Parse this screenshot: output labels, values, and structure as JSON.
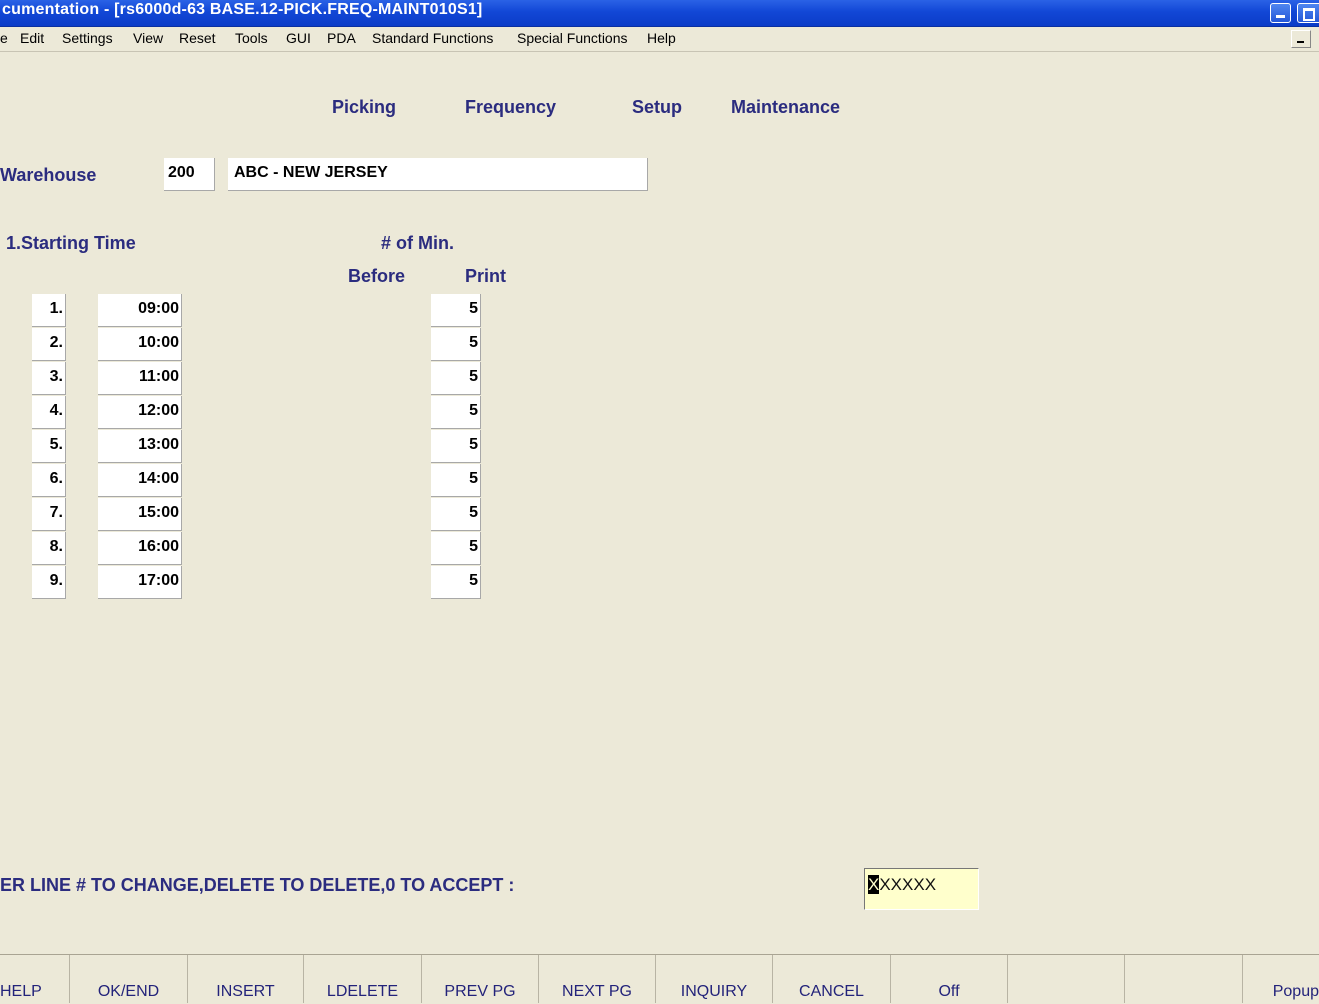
{
  "window": {
    "title": "cumentation - [rs6000d-63 BASE.12-PICK.FREQ-MAINT010S1]"
  },
  "menu": [
    "e",
    "Edit",
    "Settings",
    "View",
    "Reset",
    "Tools",
    "GUI",
    "PDA",
    "Standard Functions",
    "Special Functions",
    "Help"
  ],
  "screen": {
    "title_words": [
      "Picking",
      "Frequency",
      "Setup",
      "Maintenance"
    ],
    "warehouse_label": "Warehouse",
    "warehouse_code": "200",
    "warehouse_name": "ABC -  NEW JERSEY",
    "section_label": "1.Starting Time",
    "col_min_label": "# of Min.",
    "col_before_label": "Before",
    "col_print_label": "Print"
  },
  "rows": [
    {
      "line": "1.",
      "time": "09:00",
      "minutes": "5"
    },
    {
      "line": "2.",
      "time": "10:00",
      "minutes": "5"
    },
    {
      "line": "3.",
      "time": "11:00",
      "minutes": "5"
    },
    {
      "line": "4.",
      "time": "12:00",
      "minutes": "5"
    },
    {
      "line": "5.",
      "time": "13:00",
      "minutes": "5"
    },
    {
      "line": "6.",
      "time": "14:00",
      "minutes": "5"
    },
    {
      "line": "7.",
      "time": "15:00",
      "minutes": "5"
    },
    {
      "line": "8.",
      "time": "16:00",
      "minutes": "5"
    },
    {
      "line": "9.",
      "time": "17:00",
      "minutes": "5"
    }
  ],
  "prompt": {
    "text": "ER LINE # TO CHANGE,DELETE TO DELETE,0 TO ACCEPT  :",
    "cursor_char": "X",
    "input_rest": "XXXXX"
  },
  "function_keys": [
    "HELP",
    "OK/END",
    "INSERT",
    "LDELETE",
    "PREV PG",
    "NEXT PG",
    "INQUIRY",
    "CANCEL",
    "Off",
    "",
    "",
    "Popup"
  ]
}
